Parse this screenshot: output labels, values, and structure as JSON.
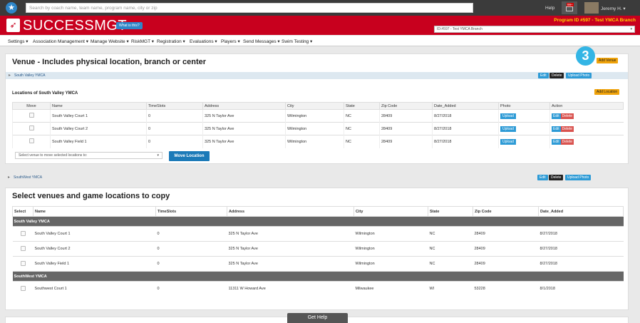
{
  "topbar": {
    "search_placeholder": "Search by coach name, team name, program name, city or zip",
    "help": "Help",
    "notif_badge": "99+",
    "user": "Jeremy H. ▾"
  },
  "brand": {
    "name": "SUCCESSMGT",
    "what_btn": "What is this?",
    "program_label": "Program ID #597 - Test YMCA Branch",
    "program_select": "ID:#597 - Test YMCA Branch"
  },
  "nav": [
    "Settings ▾",
    "Association Management ▾",
    "Manage Website ▾",
    "RiskMGT ▾",
    "Registration ▾",
    "Evaluations ▾",
    "Players ▾",
    "Send Messages ▾",
    "Swim Testing ▾"
  ],
  "venue_panel": {
    "title": "Venue - Includes physical location, branch or center",
    "add_venue": "Add Venue",
    "step_number": "3",
    "venue1": "South Valley YMCA",
    "venue2": "SouthWest YMCA",
    "edit": "Edit",
    "delete": "Delete",
    "upload_photo": "Upload Photo",
    "locations_title": "Locations of South Valley YMCA",
    "add_location": "Add Location",
    "columns": [
      "Move",
      "Name",
      "TimeSlots",
      "Address",
      "City",
      "State",
      "Zip Code",
      "Date_Added",
      "Photo",
      "Action"
    ],
    "rows": [
      [
        "South Valley Court 1",
        "0",
        "325 N Taylor Ave",
        "Wilmington",
        "NC",
        "28409",
        "8/27/2018"
      ],
      [
        "South Valley Court 2",
        "0",
        "325 N Taylor Ave",
        "Wilmington",
        "NC",
        "28409",
        "8/27/2018"
      ],
      [
        "South Valley Field 1",
        "0",
        "325 N Taylor Ave",
        "Wilmington",
        "NC",
        "28409",
        "8/27/2018"
      ]
    ],
    "upload": "Upload",
    "move_select": "Select venue to move selected locations to:",
    "move_button": "Move Location"
  },
  "copy_panel": {
    "title": "Select venues and game locations to copy",
    "columns": [
      "Select",
      "Name",
      "TimeSlots",
      "Address",
      "City",
      "State",
      "Zip Code",
      "Date_Added"
    ],
    "group1": "South Valley YMCA",
    "group2": "SouthWest YMCA",
    "rows1": [
      [
        "South Valley Court 1",
        "0",
        "325 N Taylor Ave",
        "Wilmington",
        "NC",
        "28409",
        "8/27/2018"
      ],
      [
        "South Valley Court 2",
        "0",
        "325 N Taylor Ave",
        "Wilmington",
        "NC",
        "28409",
        "8/27/2018"
      ],
      [
        "South Valley Field 1",
        "0",
        "325 N Taylor Ave",
        "Wilmington",
        "NC",
        "28409",
        "8/27/2018"
      ]
    ],
    "rows2": [
      [
        "Southwest Court 1",
        "0",
        "11311 W Howard Ave",
        "Milwaukee",
        "WI",
        "53228",
        "8/1/2018"
      ]
    ]
  },
  "get_help": "Get Help"
}
